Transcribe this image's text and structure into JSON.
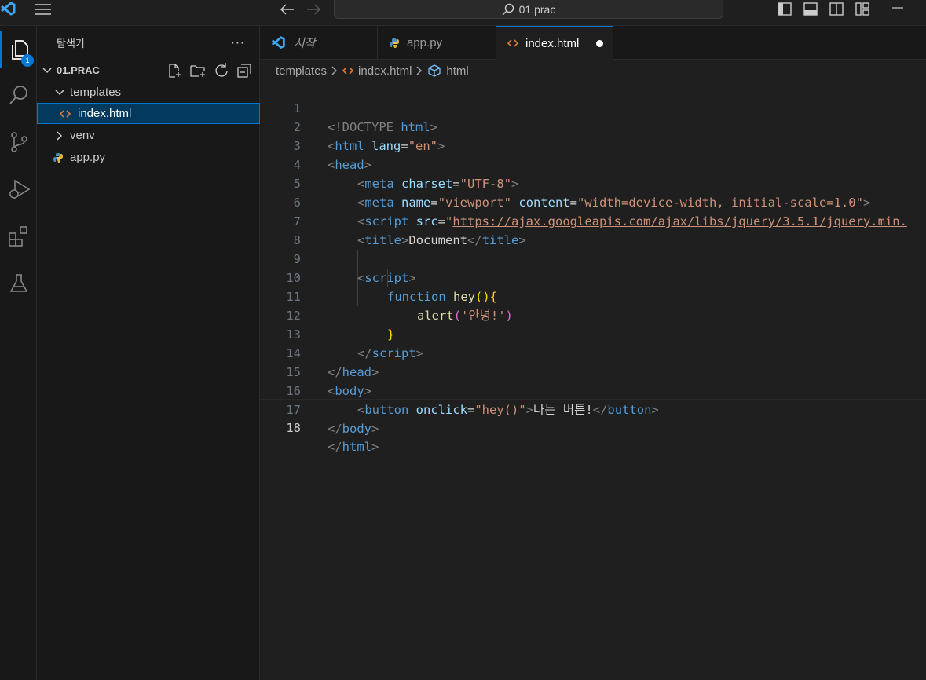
{
  "window": {
    "command_center": "01.prac"
  },
  "activity_bar": {
    "explorer_badge": "1"
  },
  "sidebar": {
    "title": "탐색기",
    "more": "···",
    "root": "01.PRAC",
    "items": [
      {
        "label": "templates"
      },
      {
        "label": "index.html"
      },
      {
        "label": "venv"
      },
      {
        "label": "app.py"
      }
    ]
  },
  "tabs": [
    {
      "label": "시작"
    },
    {
      "label": "app.py"
    },
    {
      "label": "index.html"
    }
  ],
  "breadcrumb": {
    "folder": "templates",
    "file": "index.html",
    "symbol": "html"
  },
  "code": {
    "line_numbers": [
      "1",
      "2",
      "3",
      "4",
      "5",
      "6",
      "7",
      "8",
      "9",
      "10",
      "11",
      "12",
      "13",
      "14",
      "15",
      "16",
      "17",
      "18"
    ],
    "l1": [
      "<!DOCTYPE",
      " html",
      ">"
    ],
    "l2": [
      "<",
      "html",
      " lang",
      "=",
      "\"en\"",
      ">"
    ],
    "l3": [
      "<",
      "head",
      ">"
    ],
    "l4": [
      "<",
      "meta",
      " charset",
      "=",
      "\"UTF-8\"",
      ">"
    ],
    "l5": [
      "<",
      "meta",
      " name",
      "=",
      "\"viewport\"",
      " content",
      "=",
      "\"width=device-width, initial-scale=1.0\"",
      ">"
    ],
    "l6": [
      "<",
      "script",
      " src",
      "=",
      "\"",
      "https://ajax.googleapis.com/ajax/libs/jquery/3.5.1/jquery.min."
    ],
    "l7": [
      "<",
      "title",
      ">",
      "Document",
      "</",
      "title",
      ">"
    ],
    "l9": [
      "<",
      "script",
      ">"
    ],
    "l10": [
      "function",
      " hey",
      "()",
      "{"
    ],
    "l11": [
      "alert",
      "(",
      "'안녕!'",
      ")"
    ],
    "l12": [
      "}"
    ],
    "l13": [
      "</",
      "script",
      ">"
    ],
    "l14": [
      "</",
      "head",
      ">"
    ],
    "l15": [
      "<",
      "body",
      ">"
    ],
    "l16": [
      "<",
      "button",
      " onclick",
      "=",
      "\"hey()\"",
      ">",
      "나는 버튼!",
      "</",
      "button",
      ">"
    ],
    "l17": [
      "</",
      "body",
      ">"
    ],
    "l18": [
      "</",
      "html",
      ">"
    ]
  }
}
